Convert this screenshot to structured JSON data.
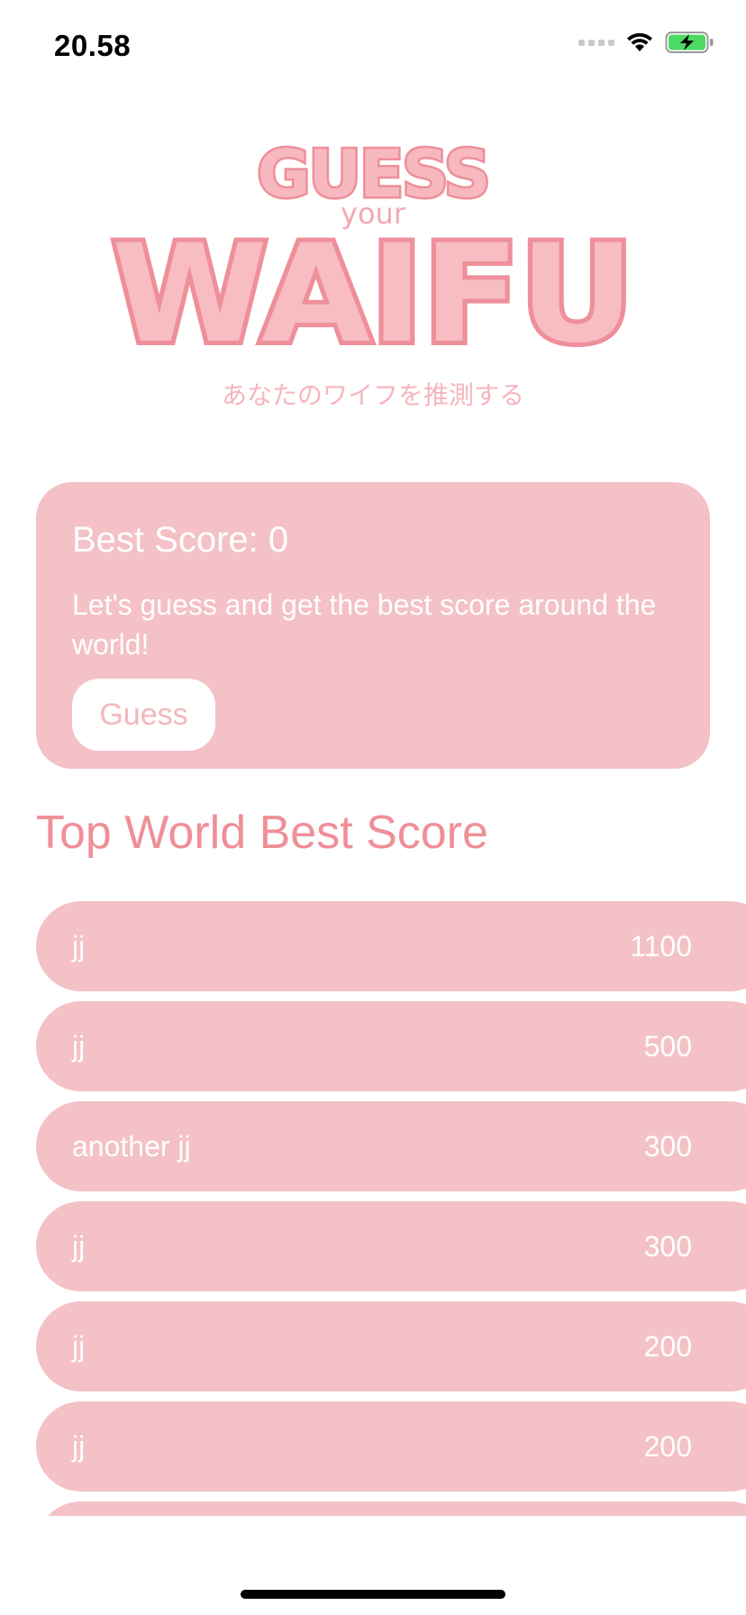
{
  "status_bar": {
    "time": "20.58",
    "icons": [
      "signal-icon",
      "wifi-icon",
      "battery-charging-icon"
    ]
  },
  "logo": {
    "line1": "GUESS",
    "line2": "your",
    "line3": "WAIFU",
    "subtitle": "あなたのワイフを推測する",
    "colors": {
      "fill": "#f4a9b2",
      "outline": "#ee8f99",
      "subtitle": "#f6b5bd"
    }
  },
  "best_card": {
    "title": "Best Score: 0",
    "description": "Let's guess and get the best score around the world!",
    "button_label": "Guess"
  },
  "leaderboard": {
    "title": "Top World Best Score",
    "rows": [
      {
        "name": "jj",
        "score": "1100"
      },
      {
        "name": "jj",
        "score": "500"
      },
      {
        "name": "another jj",
        "score": "300"
      },
      {
        "name": "jj",
        "score": "300"
      },
      {
        "name": "jj",
        "score": "200"
      },
      {
        "name": "jj",
        "score": "200"
      },
      {
        "name": "",
        "score": ""
      }
    ]
  },
  "colors": {
    "card": "#f3c1c6",
    "accent": "#ef8f98",
    "button_text": "#f3b7bd"
  }
}
